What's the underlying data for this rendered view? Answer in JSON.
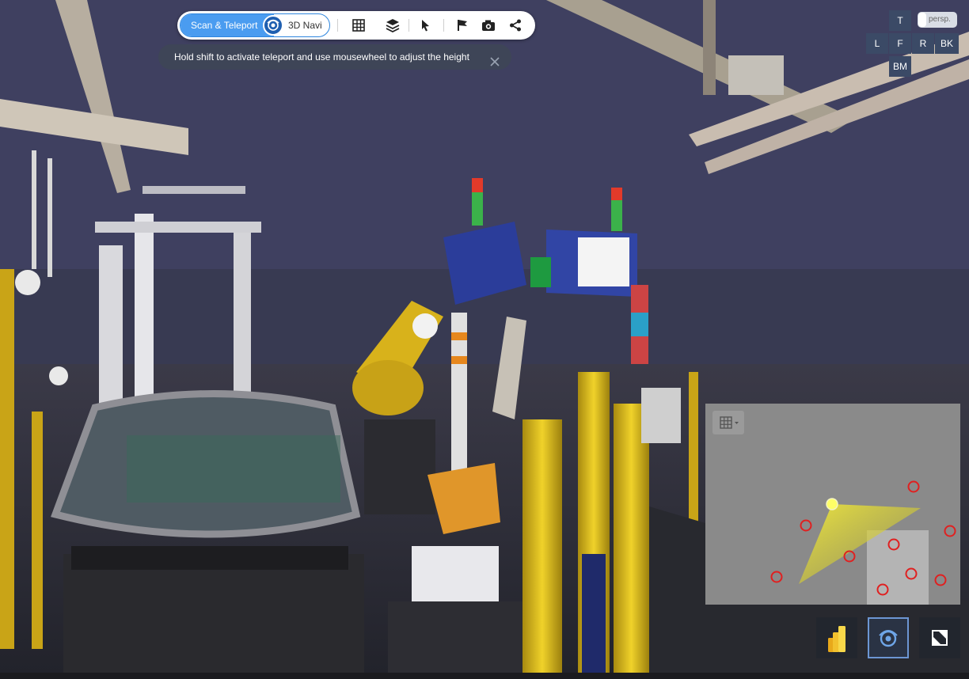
{
  "toolbar": {
    "scan_teleport_label": "Scan & Teleport",
    "navi_label": "3D Navi",
    "icons": [
      "grid-icon",
      "layers-icon",
      "pointer-icon",
      "flag-icon",
      "camera-icon",
      "share-icon"
    ]
  },
  "hint": {
    "text": "Hold shift to activate teleport and use mousewheel to adjust the height"
  },
  "view_cube": {
    "top": "T",
    "left": "L",
    "front": "F",
    "right": "R",
    "back": "BK",
    "bottom": "BM",
    "projection": "persp."
  },
  "minimap": {
    "background": "#8a8a8a",
    "camera_color": "#ffff66",
    "marker_color": "#e02020"
  },
  "colors": {
    "accent": "#4a9cf0",
    "panel_dark": "#3b4a66",
    "sky": "#3f4060"
  }
}
